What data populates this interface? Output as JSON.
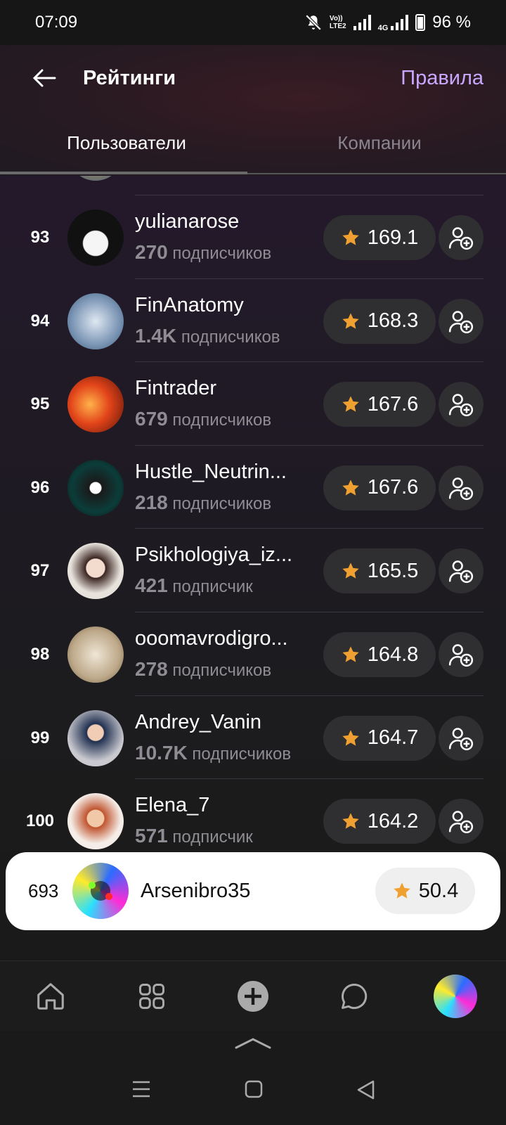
{
  "status_bar": {
    "time": "07:09",
    "net_vo": "Vo))",
    "net_lte": "LTE2",
    "net_4g": "4G",
    "battery": "96 %"
  },
  "header": {
    "title": "Рейтинги",
    "rules_label": "Правила",
    "tabs": [
      "Пользователи",
      "Компании"
    ],
    "active_tab": 0
  },
  "rows": [
    {
      "rank": "93",
      "name": "yulianarose",
      "followers_count": "270",
      "followers_word": "подписчиков",
      "score": "169.1"
    },
    {
      "rank": "94",
      "name": "FinAnatomy",
      "followers_count": "1.4K",
      "followers_word": "подписчиков",
      "score": "168.3"
    },
    {
      "rank": "95",
      "name": "Fintrader",
      "followers_count": "679",
      "followers_word": "подписчиков",
      "score": "167.6"
    },
    {
      "rank": "96",
      "name": "Hustle_Neutrin...",
      "followers_count": "218",
      "followers_word": "подписчиков",
      "score": "167.6"
    },
    {
      "rank": "97",
      "name": "Psikhologiya_iz...",
      "followers_count": "421",
      "followers_word": "подписчик",
      "score": "165.5"
    },
    {
      "rank": "98",
      "name": "ooomavrodigro...",
      "followers_count": "278",
      "followers_word": "подписчиков",
      "score": "164.8"
    },
    {
      "rank": "99",
      "name": "Andrey_Vanin",
      "followers_count": "10.7K",
      "followers_word": "подписчиков",
      "score": "164.7"
    },
    {
      "rank": "100",
      "name": "Elena_7",
      "followers_count": "571",
      "followers_word": "подписчик",
      "score": "164.2"
    }
  ],
  "my_card": {
    "rank": "693",
    "name": "Arsenibro35",
    "score": "50.4"
  },
  "nav_icons": [
    "home-icon",
    "grid-icon",
    "add-icon",
    "chat-icon",
    "profile-avatar"
  ],
  "colors": {
    "accent": "#c8a8ff",
    "star": "#f0a030"
  }
}
